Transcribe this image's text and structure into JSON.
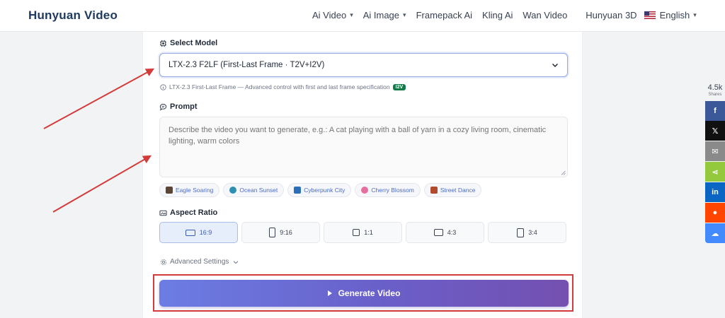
{
  "header": {
    "logo": "Hunyuan Video",
    "nav": [
      {
        "label": "Ai Video",
        "dropdown": true
      },
      {
        "label": "Ai Image",
        "dropdown": true
      },
      {
        "label": "Framepack Ai",
        "dropdown": false
      },
      {
        "label": "Kling Ai",
        "dropdown": false
      },
      {
        "label": "Wan Video",
        "dropdown": false
      },
      {
        "label": "Hunyuan 3D",
        "dropdown": false
      }
    ],
    "language": "English"
  },
  "model": {
    "label": "Select Model",
    "selected": "LTX-2.3 F2LF (First-Last Frame · T2V+I2V)",
    "hint": "LTX-2.3 First-Last Frame — Advanced control with first and last frame specification",
    "badge": "I2V"
  },
  "prompt": {
    "label": "Prompt",
    "placeholder": "Describe the video you want to generate, e.g.: A cat playing with a ball of yarn in a cozy living room, cinematic lighting, warm colors"
  },
  "chips": [
    {
      "label": "Eagle Soaring",
      "color": "#5b4636"
    },
    {
      "label": "Ocean Sunset",
      "color": "#2f8fb0"
    },
    {
      "label": "Cyberpunk City",
      "color": "#2a6fb8"
    },
    {
      "label": "Cherry Blossom",
      "color": "#e76fa0"
    },
    {
      "label": "Street Dance",
      "color": "#b24a2e"
    }
  ],
  "aspect": {
    "label": "Aspect Ratio",
    "options": [
      "16:9",
      "9:16",
      "1:1",
      "4:3",
      "3:4"
    ],
    "selected": "16:9"
  },
  "advanced": {
    "label": "Advanced Settings"
  },
  "generate": {
    "label": "Generate Video"
  },
  "share": {
    "count": "4.5k",
    "label": "Shares",
    "buttons": [
      {
        "name": "facebook",
        "color": "#3b5998",
        "glyph": "f"
      },
      {
        "name": "x",
        "color": "#111111",
        "glyph": "𝕏"
      },
      {
        "name": "email",
        "color": "#8a8a8a",
        "glyph": "✉"
      },
      {
        "name": "sharethis",
        "color": "#95c93d",
        "glyph": "⋖"
      },
      {
        "name": "linkedin",
        "color": "#0a66c2",
        "glyph": "in"
      },
      {
        "name": "reddit",
        "color": "#ff4500",
        "glyph": "●"
      },
      {
        "name": "messenger",
        "color": "#448aff",
        "glyph": "☁"
      }
    ]
  },
  "colors": {
    "accent": "#6b7de3",
    "annotation": "#d43b3b",
    "badge": "#16794a"
  }
}
